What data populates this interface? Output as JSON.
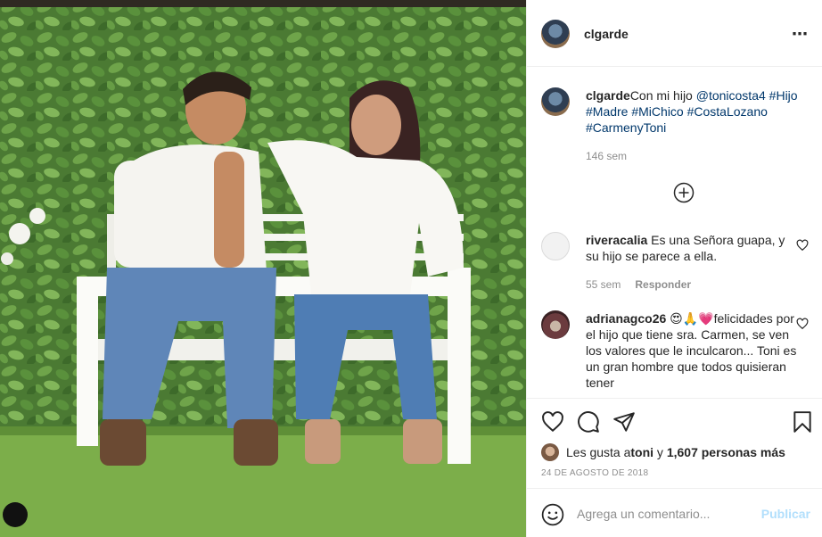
{
  "post": {
    "author": "clgarde",
    "more_icon": "⋯",
    "caption": {
      "username": "clgarde",
      "text": "Con mi hijo ",
      "mention": "@tonicosta4",
      "hashtags_line1": " #Hijo",
      "hashtags_line2": "#Madre #MiChico #CostaLozano",
      "hashtags_line3": "#CarmenyToni",
      "age": "146 sem"
    },
    "comments": [
      {
        "username": "riveracalia",
        "text": " Es una Señora guapa, y su hijo se parece a ella.",
        "age": "55 sem",
        "reply": "Responder"
      },
      {
        "username": "adrianagco26",
        "text": " 😍🙏💗felicidades por el hijo que tiene sra. Carmen, se ven los valores que le inculcaron... Toni es un gran hombre que todos quisieran tener"
      }
    ],
    "likes": {
      "prefix": "Les gusta a ",
      "user": "toni",
      "middle": " y ",
      "count": "1,607 personas más"
    },
    "date": "24 DE AGOSTO DE 2018",
    "add_comment": {
      "placeholder": "Agrega un comentario...",
      "publish": "Publicar"
    }
  },
  "colors": {
    "link": "#00376b",
    "muted": "#8e8e8e",
    "publish_disabled": "#b2dffc"
  }
}
